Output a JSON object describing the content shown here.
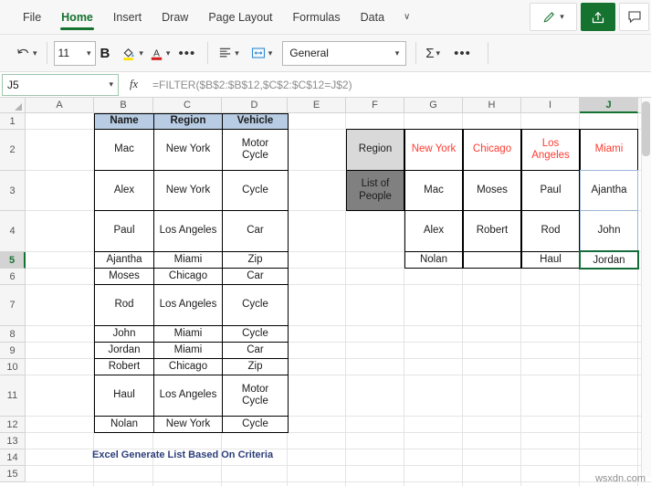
{
  "ribbon": {
    "tabs": [
      {
        "label": "File",
        "active": false
      },
      {
        "label": "Home",
        "active": true
      },
      {
        "label": "Insert",
        "active": false
      },
      {
        "label": "Draw",
        "active": false
      },
      {
        "label": "Page Layout",
        "active": false
      },
      {
        "label": "Formulas",
        "active": false
      },
      {
        "label": "Data",
        "active": false
      }
    ],
    "overflow_label": "∨",
    "draw_pen_label": "pen-icon",
    "share_label": "share-icon",
    "comment_label": "comment-icon"
  },
  "toolbar": {
    "undo_label": "undo-icon",
    "font_size": "11",
    "bold_label": "B",
    "fill_color_label": "fill-color-icon",
    "font_color_label": "A",
    "more_font_label": "•••",
    "align_label": "align-left-icon",
    "wrap_label": "wrap-text-icon",
    "number_format": "General",
    "autosum_label": "Σ",
    "more_label": "•••"
  },
  "formula_bar": {
    "name_box": "J5",
    "fx_label": "fx",
    "formula": "=FILTER($B$2:$B$12,$C$2:$C$12=J$2)"
  },
  "grid": {
    "columns": [
      "A",
      "B",
      "C",
      "D",
      "E",
      "F",
      "G",
      "H",
      "I",
      "J"
    ],
    "selected_column": "J",
    "rows": [
      "1",
      "2",
      "3",
      "4",
      "5",
      "6",
      "7",
      "8",
      "9",
      "10",
      "11",
      "12",
      "13",
      "14",
      "15"
    ],
    "selected_row": "5",
    "selected_cell": "J5",
    "selected_cell_value": "Jordan"
  },
  "source_table": {
    "headers": [
      "Name",
      "Region",
      "Vehicle"
    ],
    "rows": [
      [
        "Mac",
        "New York",
        "Motor Cycle"
      ],
      [
        "Alex",
        "New York",
        "Cycle"
      ],
      [
        "Paul",
        "Los Angeles",
        "Car"
      ],
      [
        "Ajantha",
        "Miami",
        "Zip"
      ],
      [
        "Moses",
        "Chicago",
        "Car"
      ],
      [
        "Rod",
        "Los Angeles",
        "Cycle"
      ],
      [
        "John",
        "Miami",
        "Cycle"
      ],
      [
        "Jordan",
        "Miami",
        "Car"
      ],
      [
        "Robert",
        "Chicago",
        "Zip"
      ],
      [
        "Haul",
        "Los Angeles",
        "Motor Cycle"
      ],
      [
        "Nolan",
        "New York",
        "Cycle"
      ]
    ]
  },
  "result_table": {
    "corner_top_label": "Region",
    "corner_bottom_label": "List of People",
    "region_headers": [
      "New York",
      "Chicago",
      "Los Angeles",
      "Miami"
    ],
    "columns": [
      [
        "Mac",
        "Alex",
        "Nolan"
      ],
      [
        "Moses",
        "Robert",
        ""
      ],
      [
        "Paul",
        "Rod",
        "Haul"
      ],
      [
        "Ajantha",
        "John",
        "Jordan"
      ]
    ]
  },
  "caption": "Excel Generate List Based On Criteria",
  "watermark": "wsxdn.com",
  "colors": {
    "accent_green": "#15722f",
    "header_blue": "#b8cce4",
    "region_grey": "#d9d9d9",
    "list_grey": "#808080",
    "red_header": "#ff3b30",
    "caption_blue": "#2c3e7a"
  }
}
